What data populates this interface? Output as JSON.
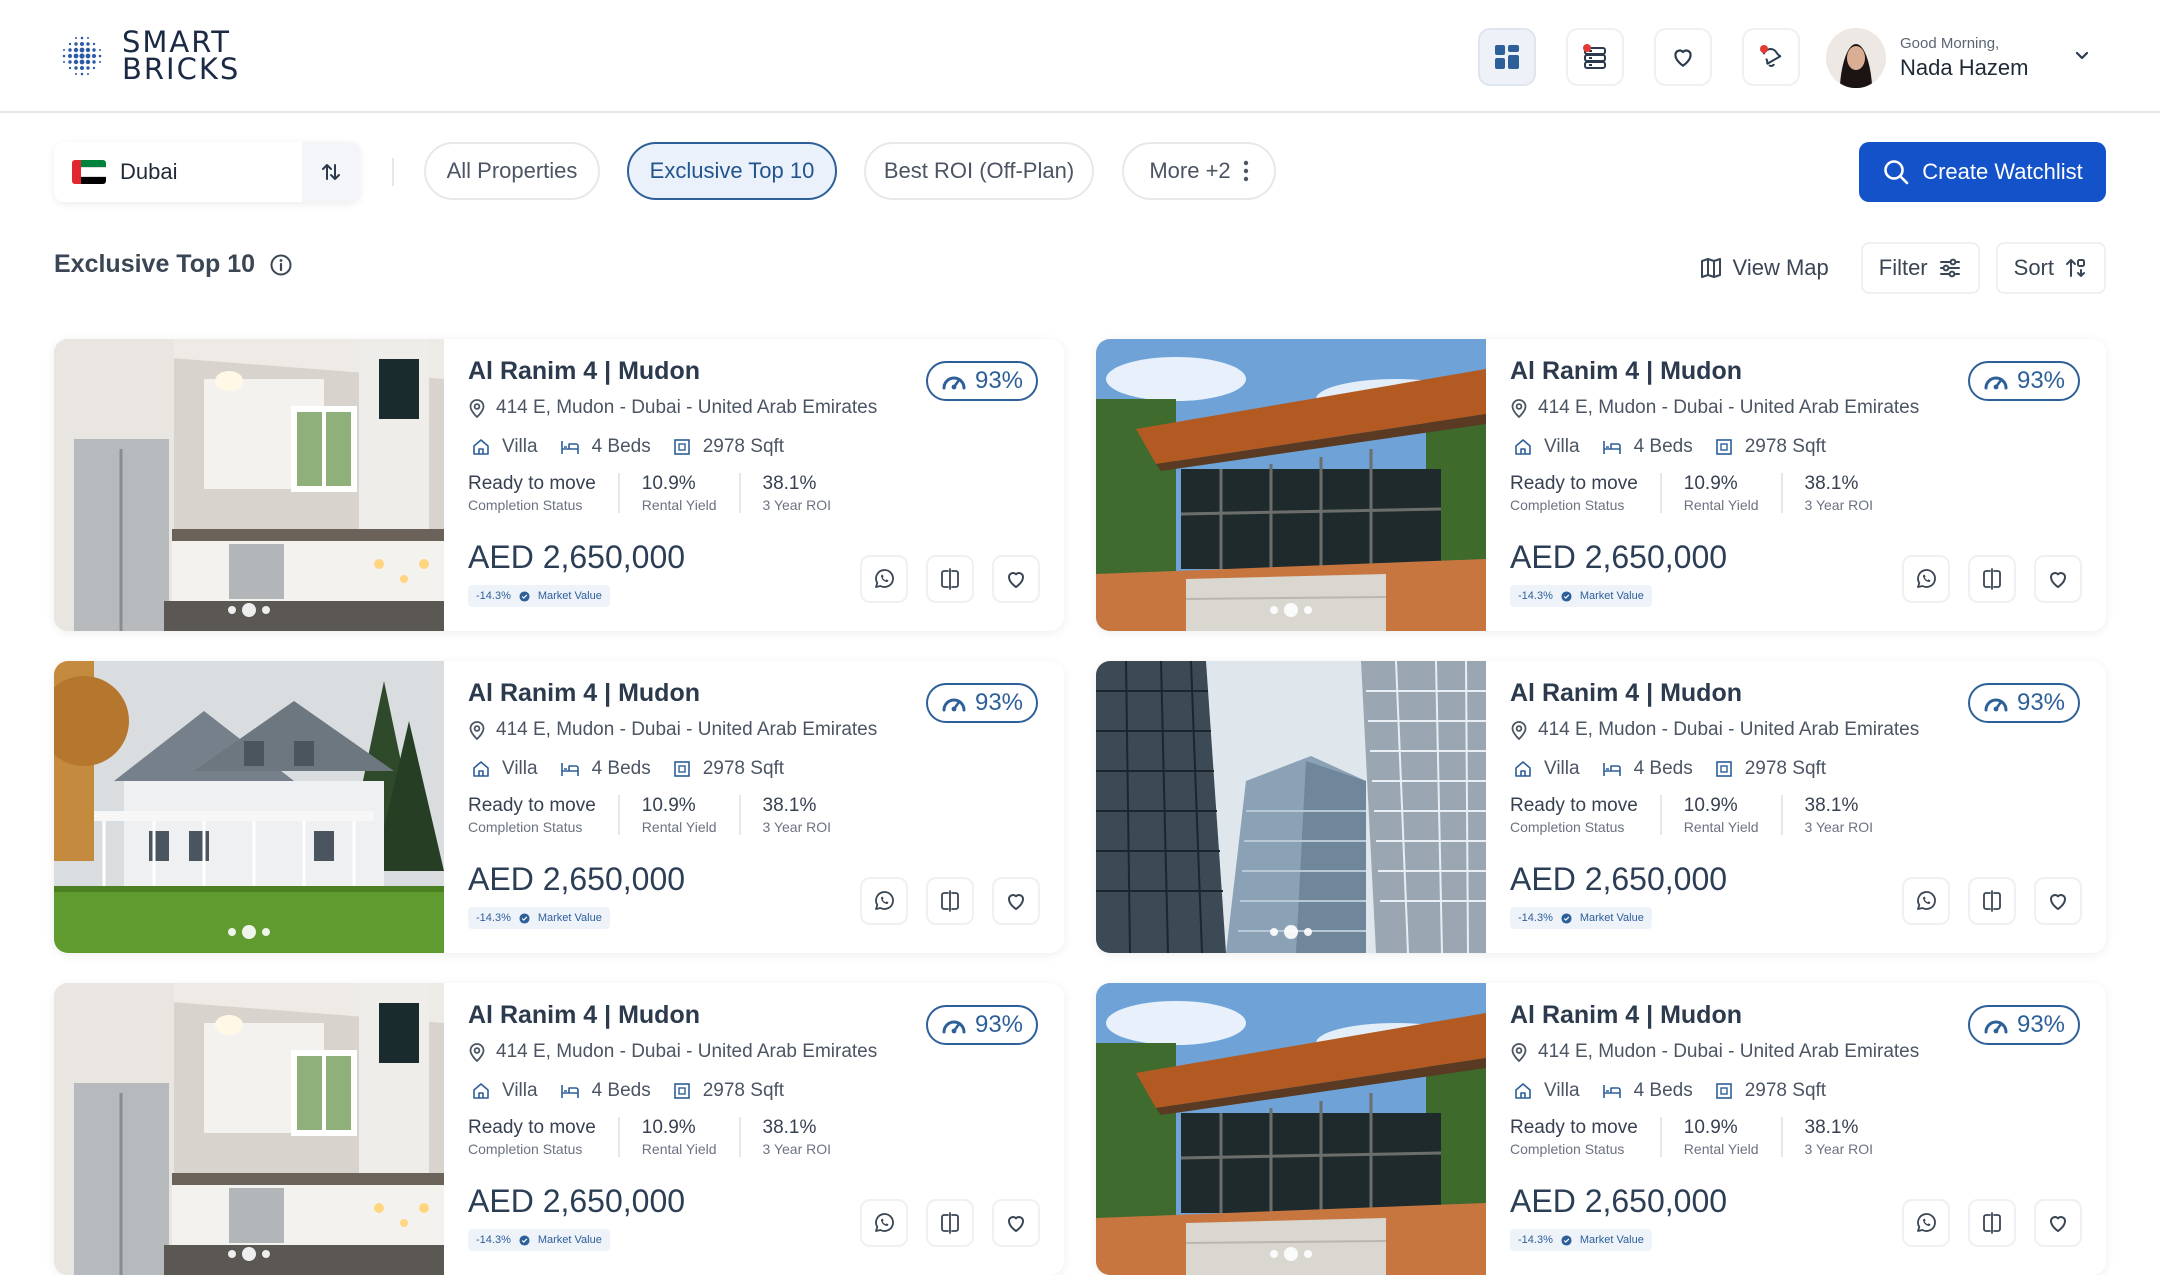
{
  "brand": {
    "line1": "SMART",
    "line2": "BRICKS"
  },
  "nav": {
    "icons": [
      "grid-icon",
      "list-icon",
      "heart-icon",
      "bell-icon"
    ],
    "user": {
      "greeting": "Good Morning,",
      "name": "Nada Hazem"
    }
  },
  "filters": {
    "city": "Dubai",
    "chips": [
      "All Properties",
      "Exclusive Top 10",
      "Best ROI (Off-Plan)",
      "More +2"
    ],
    "selected_chip": "Exclusive Top 10",
    "cta": "Create Watchlist"
  },
  "section": {
    "title": "Exclusive Top 10",
    "view_map": "View Map",
    "filter": "Filter",
    "sort": "Sort"
  },
  "cards": [
    {
      "photo": "kitchen",
      "title": "Al Ranim 4 | Mudon",
      "address": "414 E, Mudon - Dubai - United Arab Emirates",
      "type": "Villa",
      "beds": "4 Beds",
      "area": "2978 Sqft",
      "status": "Ready to move",
      "status_label": "Completion Status",
      "yield": "10.9%",
      "yield_label": "Rental Yield",
      "roi": "38.1%",
      "roi_label": "3 Year ROI",
      "price": "AED 2,650,000",
      "market_delta": "-14.3%",
      "market_label": "Market Value",
      "score": "93%"
    },
    {
      "photo": "modern-house",
      "title": "Al Ranim 4 | Mudon",
      "address": "414 E, Mudon - Dubai - United Arab Emirates",
      "type": "Villa",
      "beds": "4 Beds",
      "area": "2978 Sqft",
      "status": "Ready to move",
      "status_label": "Completion Status",
      "yield": "10.9%",
      "yield_label": "Rental Yield",
      "roi": "38.1%",
      "roi_label": "3 Year ROI",
      "price": "AED 2,650,000",
      "market_delta": "-14.3%",
      "market_label": "Market Value",
      "score": "93%"
    },
    {
      "photo": "villa",
      "title": "Al Ranim 4 | Mudon",
      "address": "414 E, Mudon - Dubai - United Arab Emirates",
      "type": "Villa",
      "beds": "4 Beds",
      "area": "2978 Sqft",
      "status": "Ready to move",
      "status_label": "Completion Status",
      "yield": "10.9%",
      "yield_label": "Rental Yield",
      "roi": "38.1%",
      "roi_label": "3 Year ROI",
      "price": "AED 2,650,000",
      "market_delta": "-14.3%",
      "market_label": "Market Value",
      "score": "93%"
    },
    {
      "photo": "towers",
      "title": "Al Ranim 4 | Mudon",
      "address": "414 E, Mudon - Dubai - United Arab Emirates",
      "type": "Villa",
      "beds": "4 Beds",
      "area": "2978 Sqft",
      "status": "Ready to move",
      "status_label": "Completion Status",
      "yield": "10.9%",
      "yield_label": "Rental Yield",
      "roi": "38.1%",
      "roi_label": "3 Year ROI",
      "price": "AED 2,650,000",
      "market_delta": "-14.3%",
      "market_label": "Market Value",
      "score": "93%"
    },
    {
      "photo": "kitchen",
      "title": "Al Ranim 4 | Mudon",
      "address": "414 E, Mudon - Dubai - United Arab Emirates",
      "type": "Villa",
      "beds": "4 Beds",
      "area": "2978 Sqft",
      "status": "Ready to move",
      "status_label": "Completion Status",
      "yield": "10.9%",
      "yield_label": "Rental Yield",
      "roi": "38.1%",
      "roi_label": "3 Year ROI",
      "price": "AED 2,650,000",
      "market_delta": "-14.3%",
      "market_label": "Market Value",
      "score": "93%"
    },
    {
      "photo": "modern-house",
      "title": "Al Ranim 4 | Mudon",
      "address": "414 E, Mudon - Dubai - United Arab Emirates",
      "type": "Villa",
      "beds": "4 Beds",
      "area": "2978 Sqft",
      "status": "Ready to move",
      "status_label": "Completion Status",
      "yield": "10.9%",
      "yield_label": "Rental Yield",
      "roi": "38.1%",
      "roi_label": "3 Year ROI",
      "price": "AED 2,650,000",
      "market_delta": "-14.3%",
      "market_label": "Market Value",
      "score": "93%"
    }
  ],
  "colors": {
    "primary": "#1452c9",
    "accent": "#2d5f99",
    "text": "#2c3a4d",
    "border": "#e6e8ec"
  }
}
